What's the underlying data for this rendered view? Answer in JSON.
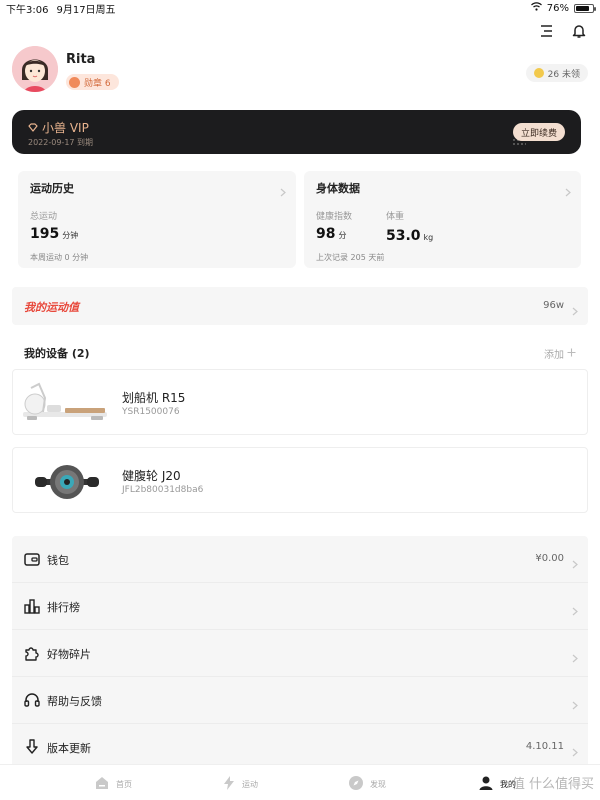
{
  "status_bar": {
    "time": "下午3:06",
    "date": "9月17日周五",
    "battery": "76%",
    "battery_level": 0.76
  },
  "profile": {
    "name": "Rita",
    "medal_label": "勋章 6",
    "coin_label": "26 未领"
  },
  "vip": {
    "title": "小兽 VIP",
    "expire": "2022-09-17 到期",
    "renew_label": "立即续费"
  },
  "history_card": {
    "title": "运动历史",
    "total_label": "总运动",
    "total_value": "195",
    "total_unit": "分钟",
    "week_note": "本周运动 0 分钟"
  },
  "body_card": {
    "title": "身体数据",
    "health_label": "健康指数",
    "health_value": "98",
    "health_unit": "分",
    "weight_label": "体重",
    "weight_value": "53.0",
    "weight_unit": "kg",
    "last_note": "上次记录 205 天前"
  },
  "motion_value": {
    "label": "我的运动值",
    "value": "96w"
  },
  "devices": {
    "heading": "我的设备 (2)",
    "add_label": "添加",
    "items": [
      {
        "name": "划船机 R15",
        "serial": "YSR1500076"
      },
      {
        "name": "健腹轮 J20",
        "serial": "JFL2b80031d8ba6"
      }
    ]
  },
  "menu": {
    "items": [
      {
        "label": "钱包",
        "value": "¥0.00",
        "icon": "wallet-icon"
      },
      {
        "label": "排行榜",
        "value": "",
        "icon": "bar-chart-icon"
      },
      {
        "label": "好物碎片",
        "value": "",
        "icon": "puzzle-icon"
      },
      {
        "label": "帮助与反馈",
        "value": "",
        "icon": "headset-icon"
      },
      {
        "label": "版本更新",
        "value": "4.10.11",
        "icon": "download-arrow-icon"
      }
    ]
  },
  "tabs": [
    {
      "label": "首页",
      "icon": "home-icon"
    },
    {
      "label": "运动",
      "icon": "lightning-icon"
    },
    {
      "label": "发现",
      "icon": "compass-icon"
    },
    {
      "label": "我的",
      "icon": "profile-icon"
    }
  ],
  "watermark": "值 什么值得买",
  "colors": {
    "accent_red": "#e8493c",
    "vip_bg": "#1c1c1e",
    "vip_gold": "#e9b48f",
    "card_bg": "#f6f6f6"
  }
}
